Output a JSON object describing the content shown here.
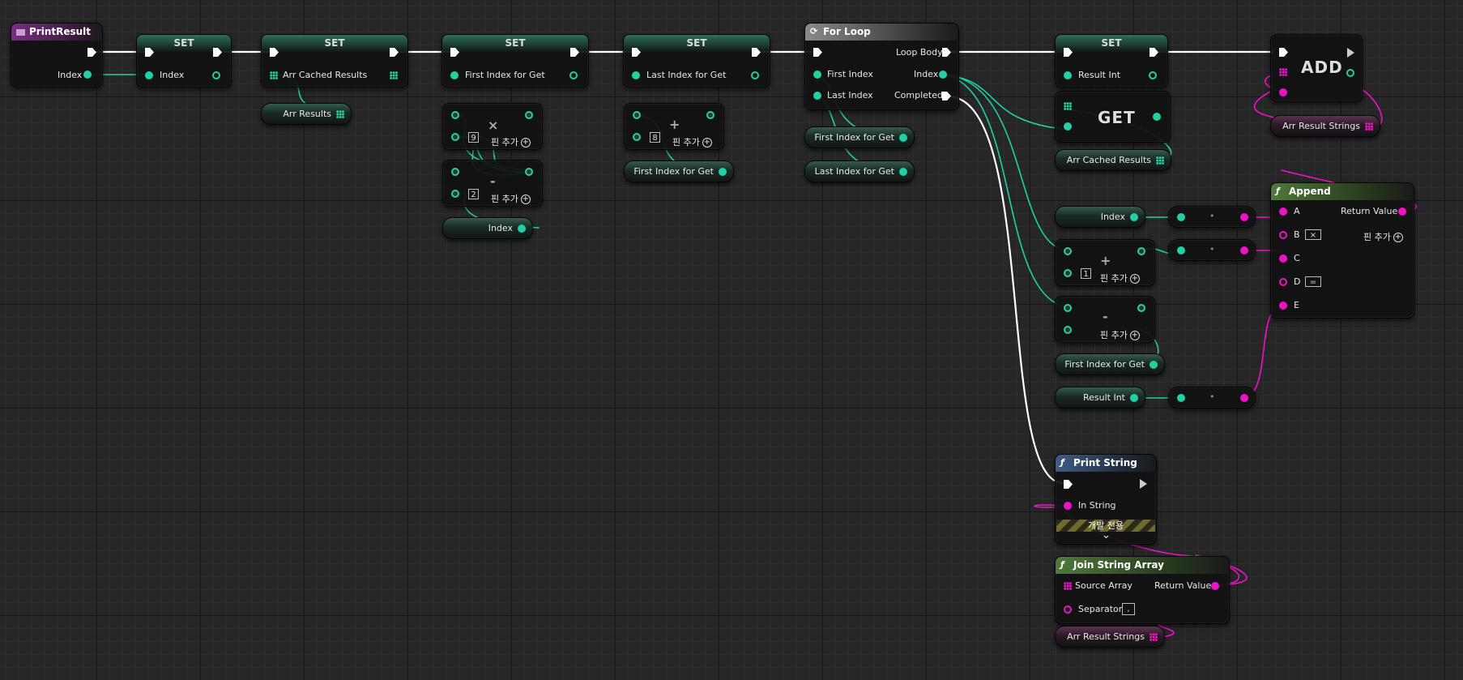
{
  "event": {
    "title": "PrintResult",
    "pin_index": "Index"
  },
  "set_nodes": {
    "title": "SET",
    "index": "Index",
    "arr_cached_results": "Arr Cached Results",
    "first_index_for_get": "First Index for Get",
    "last_index_for_get": "Last Index for Get",
    "result_int": "Result Int"
  },
  "getters": {
    "arr_results": "Arr Results",
    "first_index_for_get": "First Index for Get",
    "index": "Index",
    "arr_cached_results": "Arr Cached Results",
    "result_int": "Result Int",
    "arr_result_strings": "Arr Result Strings"
  },
  "math": {
    "multiply_symbol": "×",
    "add_symbol": "+",
    "subtract_symbol": "-",
    "add_pin_label": "핀 추가",
    "mul_value": "9",
    "sub_value": "2",
    "add_value": "8",
    "inc_value": "1",
    "dot": "•"
  },
  "for_loop": {
    "title": "For Loop",
    "loop_body": "Loop Body",
    "first_index": "First Index",
    "last_index": "Last Index",
    "index": "Index",
    "completed": "Completed"
  },
  "array_get": {
    "label": "GET"
  },
  "array_add": {
    "label": "ADD"
  },
  "append": {
    "title": "Append",
    "a": "A",
    "b": "B",
    "c": "C",
    "d": "D",
    "e": "E",
    "b_value": "×",
    "d_value": "=",
    "return_value": "Return Value"
  },
  "print_string": {
    "title": "Print String",
    "in_string": "In String",
    "dev_only": "개발 전용",
    "expand": "⌄"
  },
  "join_string_array": {
    "title": "Join String Array",
    "source_array": "Source Array",
    "separator": "Separator",
    "separator_value": ",",
    "return_value": "Return Value"
  },
  "colors": {
    "int_pin": "#1fd1a4",
    "string_pin": "#f010c8",
    "exec": "#ffffff",
    "background": "#262626"
  }
}
